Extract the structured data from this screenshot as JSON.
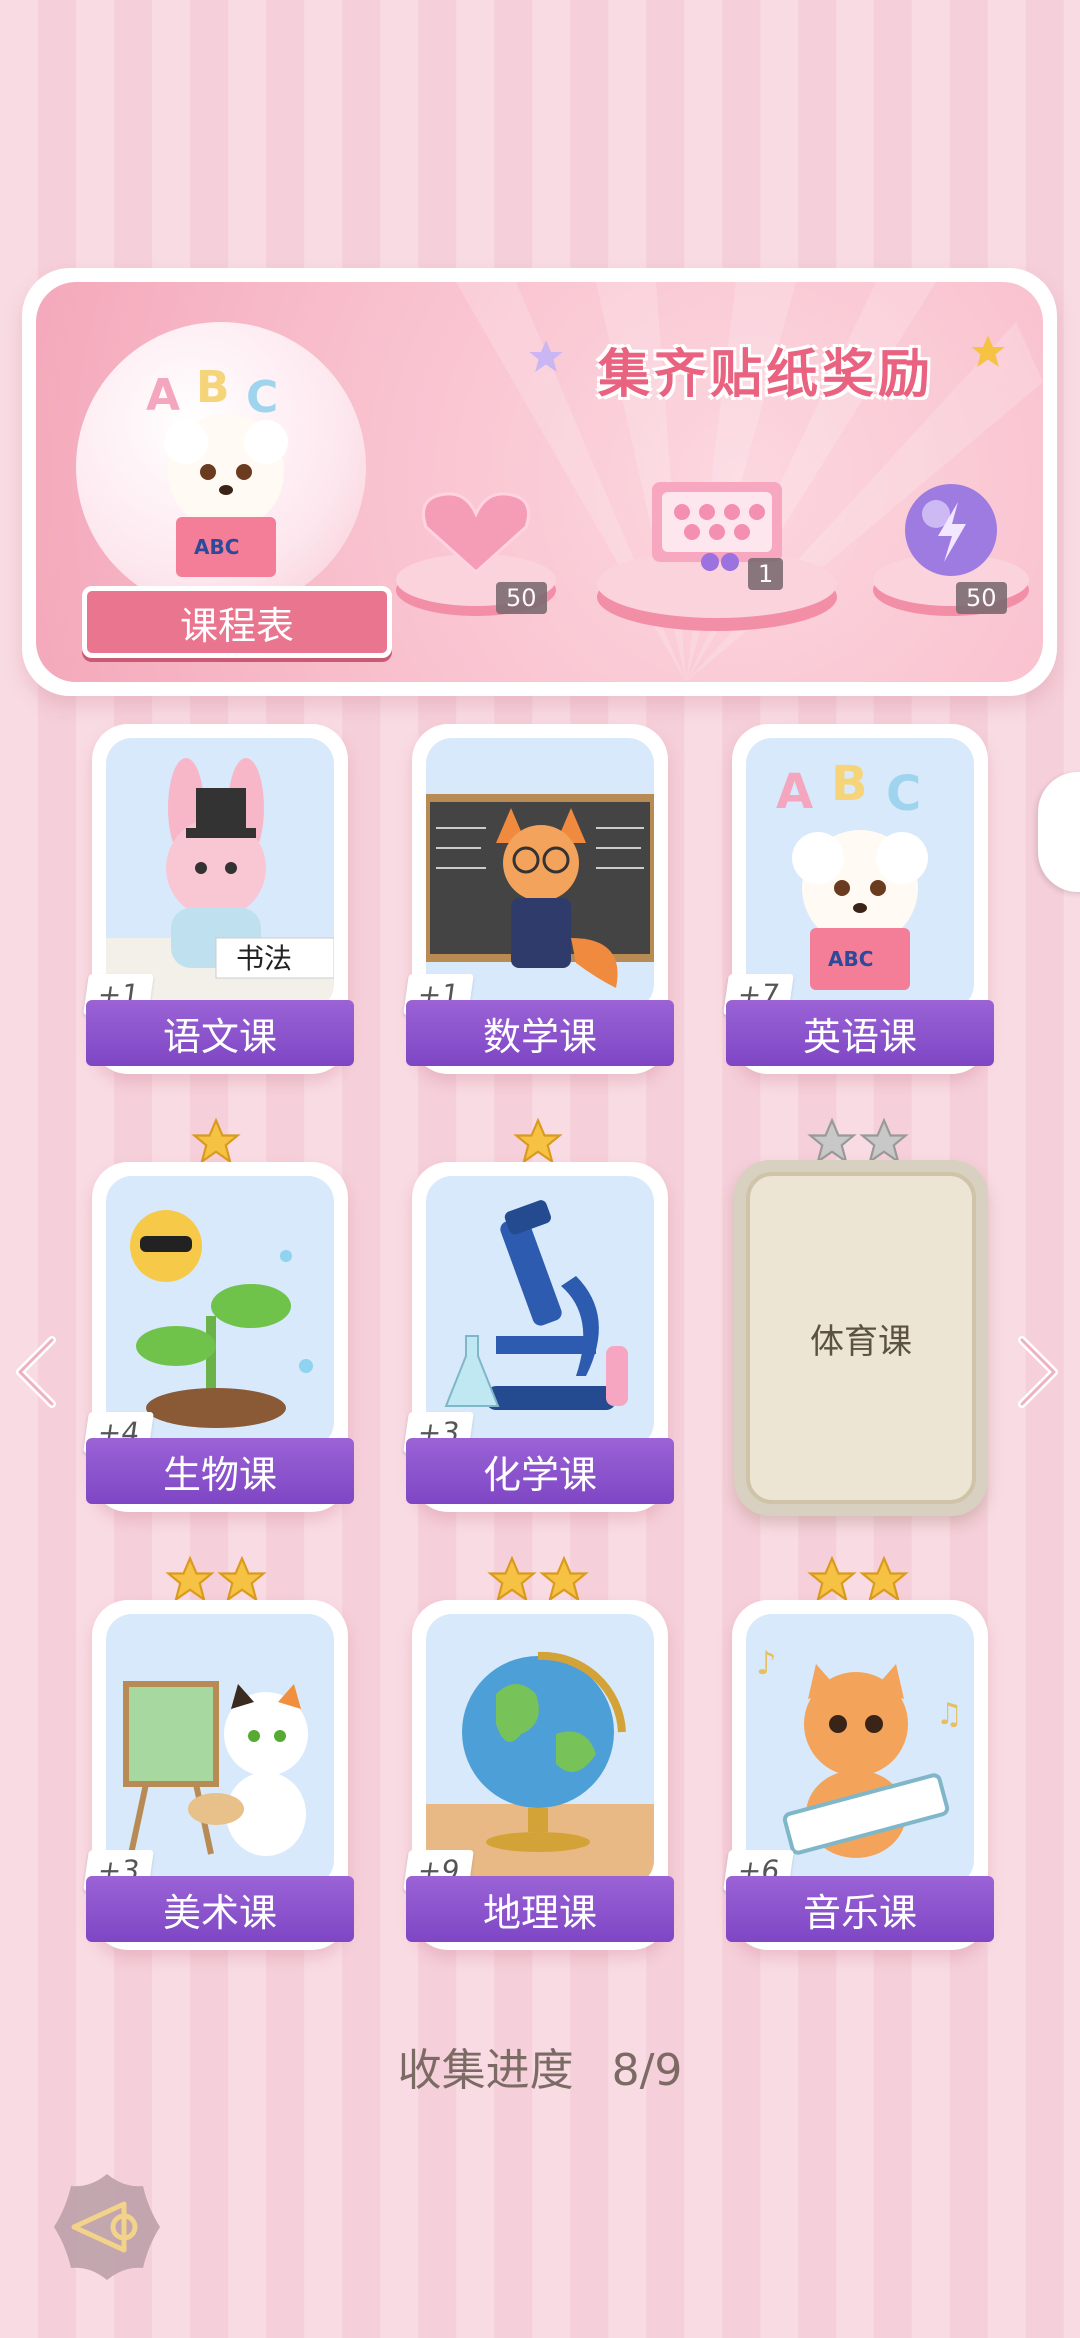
{
  "banner": {
    "title": "集齐贴纸奖励",
    "schedule_label": "课程表",
    "rewards": [
      {
        "icon": "heart-gem-icon",
        "count": "50"
      },
      {
        "icon": "gift-box-icon",
        "count": "1"
      },
      {
        "icon": "purple-orb-icon",
        "count": "50"
      }
    ]
  },
  "courses": [
    {
      "name": "语文课",
      "count": "+1",
      "stars": 0,
      "icon": "bunny-calligraphy"
    },
    {
      "name": "数学课",
      "count": "+1",
      "stars": 0,
      "icon": "fox-teacher"
    },
    {
      "name": "英语课",
      "count": "+7",
      "stars": 0,
      "icon": "puppy-reading"
    },
    {
      "name": "生物课",
      "count": "+4",
      "stars": 1,
      "icon": "sprout-sun"
    },
    {
      "name": "化学课",
      "count": "+3",
      "stars": 1,
      "icon": "microscope"
    },
    {
      "name": "体育课",
      "count": "",
      "stars": 2,
      "locked": true
    },
    {
      "name": "美术课",
      "count": "+3",
      "stars": 2,
      "icon": "cat-painter"
    },
    {
      "name": "地理课",
      "count": "+9",
      "stars": 2,
      "icon": "globe"
    },
    {
      "name": "音乐课",
      "count": "+6",
      "stars": 2,
      "icon": "cat-keyboard"
    }
  ],
  "progress": {
    "label": "收集进度",
    "value": "8/9"
  },
  "colors": {
    "accent_pink": "#e9758f",
    "label_purple": "#8b52cc",
    "star_gold": "#f6c244"
  }
}
